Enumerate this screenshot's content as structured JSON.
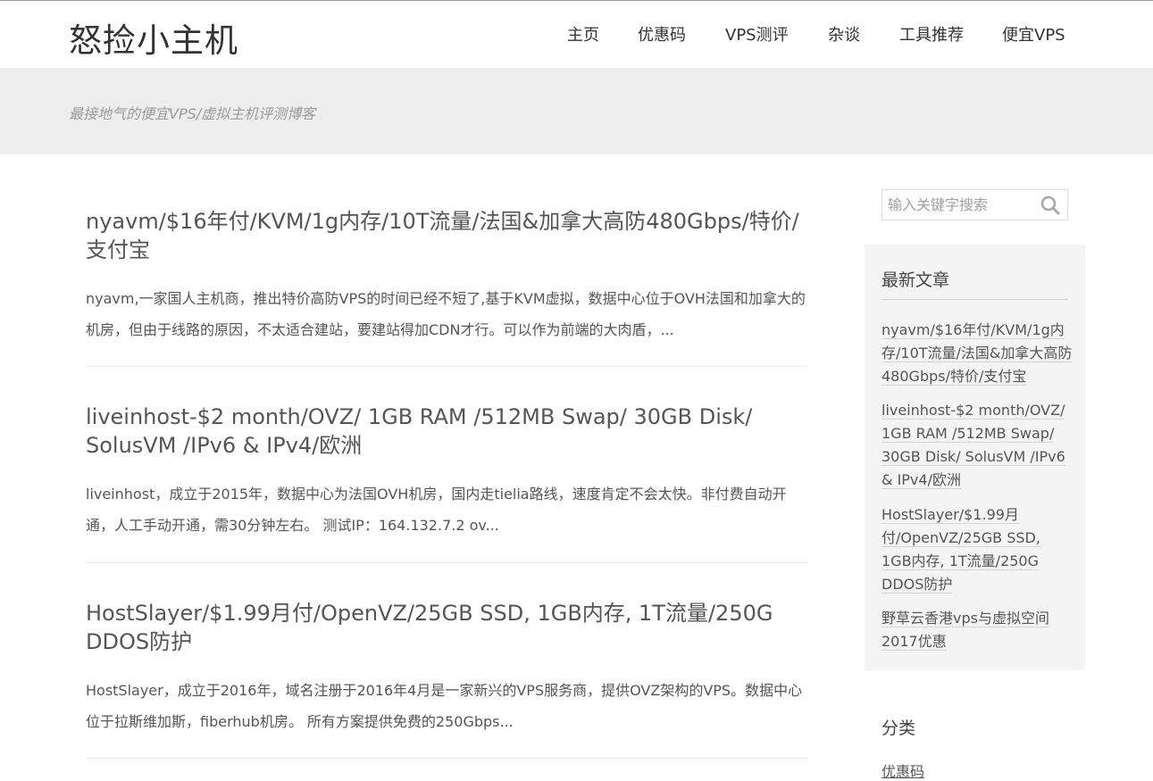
{
  "site": {
    "title": "怒捡小主机",
    "tagline": "最接地气的便宜VPS/虚拟主机评测博客"
  },
  "nav": {
    "items": [
      "主页",
      "优惠码",
      "VPS测评",
      "杂谈",
      "工具推荐",
      "便宜VPS"
    ]
  },
  "posts": [
    {
      "title": "nyavm/$16年付/KVM/1g内存/10T流量/法国&加拿大高防480Gbps/特价/支付宝",
      "excerpt": "nyavm,一家国人主机商，推出特价高防VPS的时间已经不短了,基于KVM虚拟，数据中心位于OVH法国和加拿大的机房，但由于线路的原因，不太适合建站，要建站得加CDN才行。可以作为前端的大肉盾，..."
    },
    {
      "title": "liveinhost-$2 month/OVZ/ 1GB RAM /512MB Swap/ 30GB Disk/ SolusVM /IPv6 & IPv4/欧洲",
      "excerpt": "liveinhost，成立于2015年，数据中心为法国OVH机房，国内走tielia路线，速度肯定不会太快。非付费自动开通，人工手动开通，需30分钟左右。 测试IP：164.132.7.2 ov..."
    },
    {
      "title": "HostSlayer/$1.99月付/OpenVZ/25GB SSD, 1GB内存, 1T流量/250G DDOS防护",
      "excerpt": "HostSlayer，成立于2016年，域名注册于2016年4月是一家新兴的VPS服务商，提供OVZ架构的VPS。数据中心位于拉斯维加斯，fiberhub机房。 所有方案提供免费的250Gbps..."
    }
  ],
  "sidebar": {
    "search": {
      "placeholder": "输入关键字搜索"
    },
    "recent": {
      "title": "最新文章",
      "items": [
        "nyavm/$16年付/KVM/1g内存/10T流量/法国&加拿大高防480Gbps/特价/支付宝",
        "liveinhost-$2 month/OVZ/ 1GB RAM /512MB Swap/ 30GB Disk/ SolusVM /IPv6 & IPv4/欧洲",
        "HostSlayer/$1.99月付/OpenVZ/25GB SSD, 1GB内存, 1T流量/250G DDOS防护",
        "野草云香港vps与虚拟空间2017优惠"
      ]
    },
    "categories": {
      "title": "分类",
      "items": [
        "优惠码"
      ]
    }
  },
  "colors": {
    "header_bg": "#ffffff",
    "tagline_bg": "#ededed",
    "widget_bg": "#f4f4f5",
    "text": "#555555"
  },
  "icons": {
    "search": "search-icon"
  }
}
